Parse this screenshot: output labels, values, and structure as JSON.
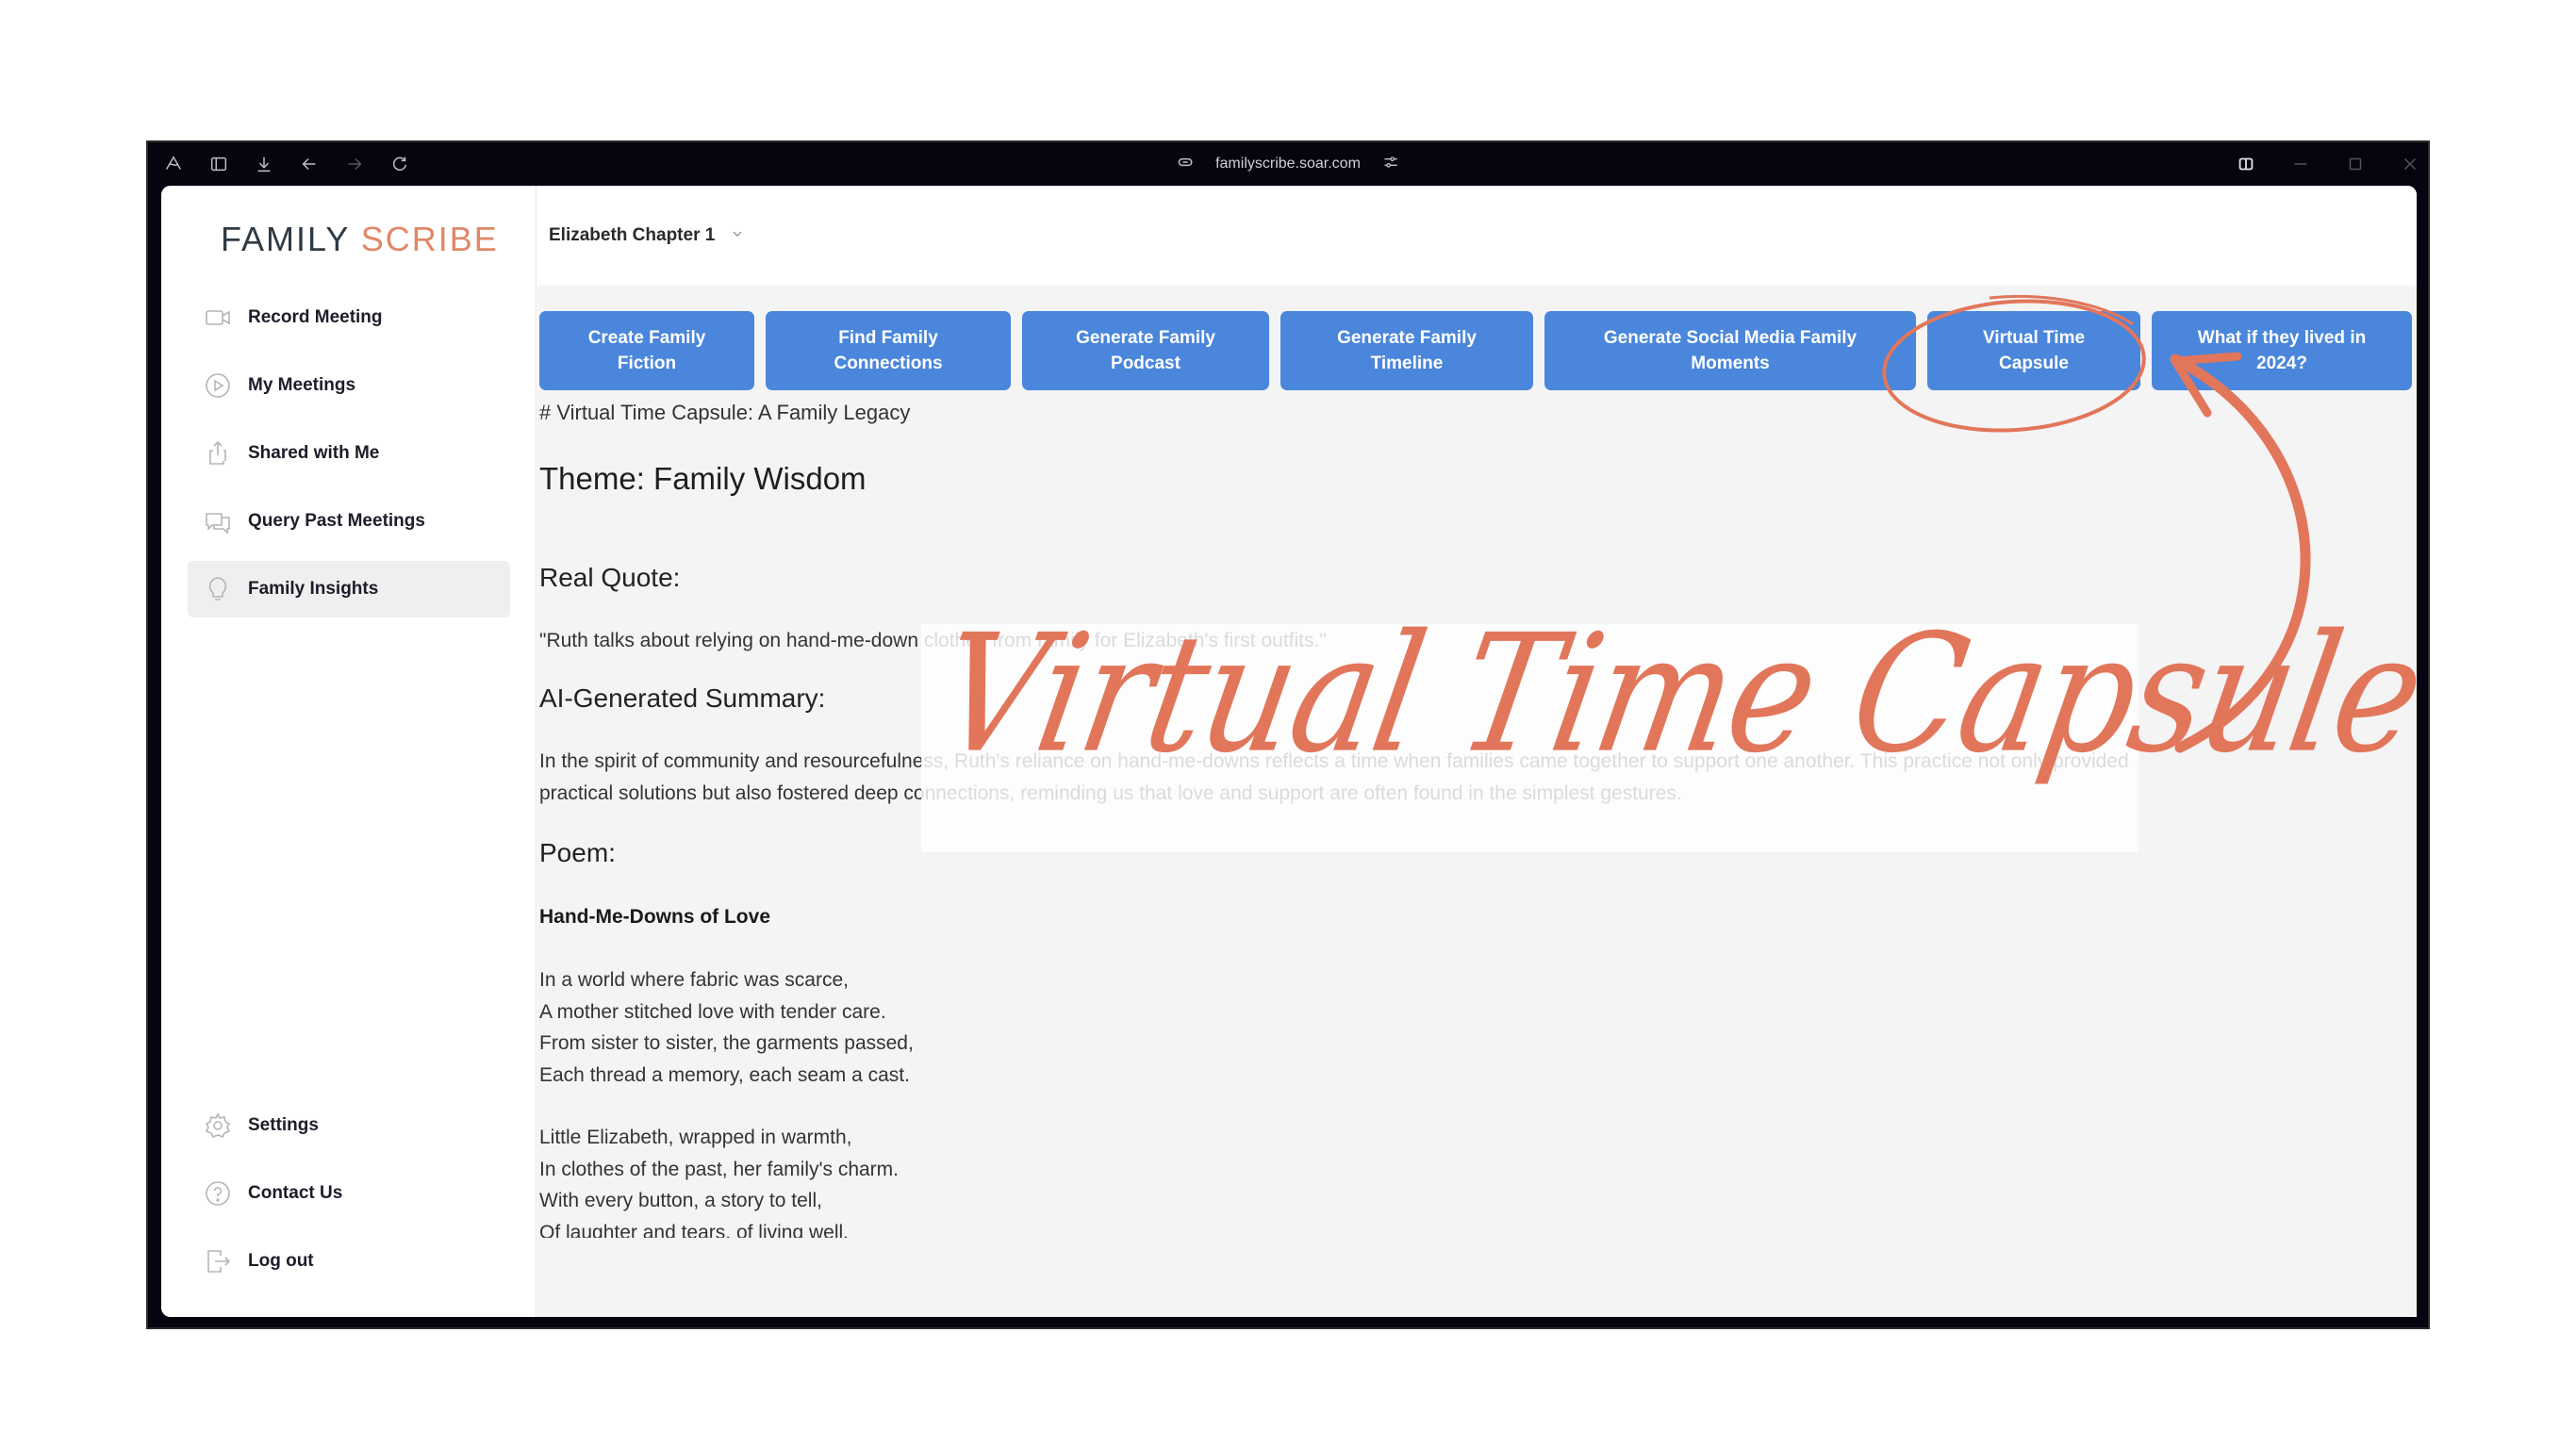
{
  "browser": {
    "url": "familyscribe.soar.com",
    "icons": [
      "app-logo-icon",
      "sidebar-toggle-icon",
      "download-icon",
      "back-icon",
      "forward-icon",
      "reload-icon",
      "link-icon",
      "site-settings-icon",
      "split-view-icon",
      "minimize-icon",
      "maximize-icon",
      "close-icon"
    ]
  },
  "logo": {
    "part1": "FAMILY",
    "part2": "SCRIBE"
  },
  "sidebar": {
    "items": [
      {
        "label": "Record Meeting",
        "icon": "video-camera-icon"
      },
      {
        "label": "My Meetings",
        "icon": "play-circle-icon"
      },
      {
        "label": "Shared with Me",
        "icon": "share-icon"
      },
      {
        "label": "Query Past Meetings",
        "icon": "chat-bubbles-icon"
      },
      {
        "label": "Family Insights",
        "icon": "lightbulb-icon",
        "active": true
      }
    ],
    "bottom_items": [
      {
        "label": "Settings",
        "icon": "gear-icon"
      },
      {
        "label": "Contact Us",
        "icon": "help-circle-icon"
      },
      {
        "label": "Log out",
        "icon": "logout-icon"
      }
    ]
  },
  "header": {
    "chapter_select": "Elizabeth Chapter 1"
  },
  "actions": [
    {
      "line1": "Create Family",
      "line2": "Fiction"
    },
    {
      "line1": "Find Family",
      "line2": "Connections"
    },
    {
      "line1": "Generate Family",
      "line2": "Podcast"
    },
    {
      "line1": "Generate Family",
      "line2": "Timeline"
    },
    {
      "line1": "Generate Social Media Family",
      "line2": "Moments"
    },
    {
      "line1": "Virtual Time",
      "line2": "Capsule"
    },
    {
      "line1": "What if they lived in",
      "line2": "2024?"
    }
  ],
  "content": {
    "md_heading": "# Virtual Time Capsule: A Family Legacy",
    "theme": "Theme: Family Wisdom",
    "quote_heading": "Real Quote:",
    "quote": "\"Ruth talks about relying on hand-me-down clothes from family for Elizabeth's first outfits.\"",
    "summary_heading": "AI-Generated Summary:",
    "summary_line1": "In the spirit of community and resourcefulness, Ruth's reliance on hand-me-downs reflects a time when families came together to support one another. This practice not only provided",
    "summary_line2": "practical solutions but also fostered deep connections, reminding us that love and support are often found in the simplest gestures.",
    "poem_heading": "Poem:",
    "poem_title": "Hand-Me-Downs of Love",
    "stanza1": [
      "In a world where fabric was scarce,",
      "A mother stitched love with tender care.",
      "From sister to sister, the garments passed,",
      "Each thread a memory, each seam a cast."
    ],
    "stanza2": [
      "Little Elizabeth, wrapped in warmth,",
      "In clothes of the past, her family's charm.",
      "With every button, a story to tell,",
      "Of laughter and tears, of living well."
    ]
  },
  "annotation": {
    "title": "Virtual Time Capsule",
    "color": "#e2765a"
  },
  "colors": {
    "button": "#4a86db",
    "logo_accent": "#e08867",
    "logo_dark": "#2f3a45"
  }
}
